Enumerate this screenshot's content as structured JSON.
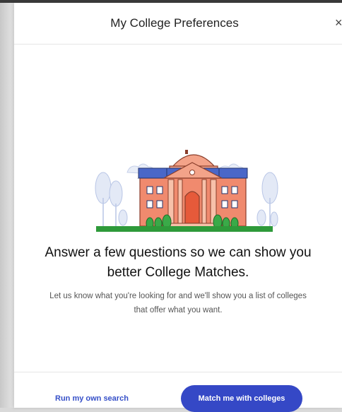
{
  "modal": {
    "title": "My College Preferences",
    "close_glyph": "×"
  },
  "content": {
    "headline": "Answer a few questions so we can show you better College Matches.",
    "subtext": "Let us know what you're looking for and we'll show you a list of colleges that offer what you want."
  },
  "footer": {
    "secondary_label": "Run my own search",
    "primary_label": "Match me with colleges"
  },
  "icons": {
    "close": "close-icon",
    "illustration": "college-building-illustration"
  },
  "colors": {
    "primary": "#3548c6",
    "link": "#3650c8",
    "building": "#f08a6e",
    "roof": "#4a67c8",
    "grass": "#2e9a3a"
  }
}
